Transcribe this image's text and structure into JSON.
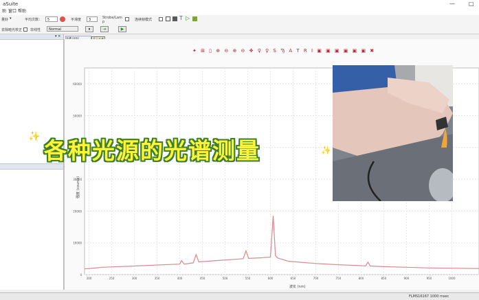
{
  "titlebar": {
    "title": "aSuite",
    "minimize": "—",
    "maximize": "□"
  },
  "menu": {
    "items": [
      "助",
      "窗口",
      "帮助"
    ]
  },
  "toolbar": {
    "row1": {
      "mode_label": "量好",
      "average_label": "平均次数：",
      "average_value": "5",
      "smooth_label": "平滑度",
      "smooth_value": "3",
      "strobe_label": "Strobe/Lam",
      "strobe_sub": "p",
      "auto_label": "连续帧模式"
    },
    "row2": {
      "dark_label": "去除暗光校正",
      "nonlinear_label": "非线性",
      "normal_value": "Normal"
    },
    "tooltip": "显示光谱"
  },
  "plot": {
    "tab_label": "光谱 (nm)",
    "toolbar_icons": "✦ ⊞ ▯ ⊕ ⊖ ⊕ ⊖ ✥  ♀ ♀  S Ϡ A T R I  ▣ ▣ ▣ ▣ ▣ ▣  ✖"
  },
  "overlay": {
    "text": "各种光源的光谱测量"
  },
  "status": {
    "device": "FLMS16167  1000 msec"
  },
  "chart_data": {
    "type": "line",
    "xlabel": "波长 (nm)",
    "ylabel": "强度 (counts)",
    "xlim": [
      190,
      1060
    ],
    "ylim": [
      0,
      65000
    ],
    "xticks": [
      "200",
      "250",
      "300",
      "350",
      "400",
      "450",
      "500",
      "550",
      "600",
      "650",
      "700",
      "750",
      "800",
      "850",
      "900",
      "950",
      "1000"
    ],
    "yticks": [
      "0",
      "10000",
      "20000",
      "30000",
      "40000",
      "50000",
      "60000"
    ],
    "line_color": "#d9878d",
    "series": [
      {
        "x": [
          190,
          230,
          300,
          380,
          400,
          404,
          410,
          430,
          436,
          442,
          480,
          520,
          540,
          546,
          552,
          580,
          600,
          606,
          611,
          616,
          640,
          700,
          750,
          800,
          810,
          815,
          820,
          850,
          900,
          950,
          1000,
          1060
        ],
        "y": [
          1800,
          2300,
          2700,
          3200,
          3300,
          4400,
          3300,
          3700,
          6300,
          4000,
          4400,
          4800,
          5000,
          7500,
          5100,
          5300,
          5500,
          18500,
          6000,
          5200,
          4200,
          3500,
          3100,
          2800,
          2750,
          3900,
          2700,
          2500,
          2300,
          2100,
          2000,
          1900
        ]
      }
    ]
  }
}
